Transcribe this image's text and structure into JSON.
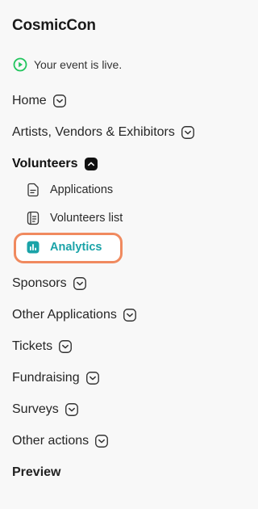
{
  "app": {
    "title": "CosmicCon"
  },
  "status": {
    "text": "Your event is live.",
    "color": "#22c55e",
    "icon": "play-circle-icon"
  },
  "nav": {
    "home": "Home",
    "artists": "Artists, Vendors & Exhibitors",
    "volunteers": {
      "label": "Volunteers",
      "expanded": true,
      "children": {
        "applications": "Applications",
        "list": "Volunteers list",
        "analytics": "Analytics"
      }
    },
    "sponsors": "Sponsors",
    "other_applications": "Other Applications",
    "tickets": "Tickets",
    "fundraising": "Fundraising",
    "surveys": "Surveys",
    "other_actions": "Other actions",
    "preview": "Preview"
  },
  "colors": {
    "accent": "#1aa3a8",
    "highlight_border": "#f08a5f"
  }
}
